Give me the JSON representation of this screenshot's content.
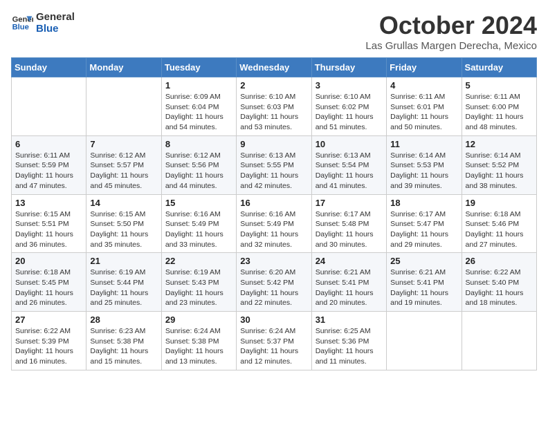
{
  "logo": {
    "line1": "General",
    "line2": "Blue"
  },
  "title": "October 2024",
  "location": "Las Grullas Margen Derecha, Mexico",
  "days_of_week": [
    "Sunday",
    "Monday",
    "Tuesday",
    "Wednesday",
    "Thursday",
    "Friday",
    "Saturday"
  ],
  "weeks": [
    [
      {
        "day": "",
        "info": ""
      },
      {
        "day": "",
        "info": ""
      },
      {
        "day": "1",
        "info": "Sunrise: 6:09 AM\nSunset: 6:04 PM\nDaylight: 11 hours and 54 minutes."
      },
      {
        "day": "2",
        "info": "Sunrise: 6:10 AM\nSunset: 6:03 PM\nDaylight: 11 hours and 53 minutes."
      },
      {
        "day": "3",
        "info": "Sunrise: 6:10 AM\nSunset: 6:02 PM\nDaylight: 11 hours and 51 minutes."
      },
      {
        "day": "4",
        "info": "Sunrise: 6:11 AM\nSunset: 6:01 PM\nDaylight: 11 hours and 50 minutes."
      },
      {
        "day": "5",
        "info": "Sunrise: 6:11 AM\nSunset: 6:00 PM\nDaylight: 11 hours and 48 minutes."
      }
    ],
    [
      {
        "day": "6",
        "info": "Sunrise: 6:11 AM\nSunset: 5:59 PM\nDaylight: 11 hours and 47 minutes."
      },
      {
        "day": "7",
        "info": "Sunrise: 6:12 AM\nSunset: 5:57 PM\nDaylight: 11 hours and 45 minutes."
      },
      {
        "day": "8",
        "info": "Sunrise: 6:12 AM\nSunset: 5:56 PM\nDaylight: 11 hours and 44 minutes."
      },
      {
        "day": "9",
        "info": "Sunrise: 6:13 AM\nSunset: 5:55 PM\nDaylight: 11 hours and 42 minutes."
      },
      {
        "day": "10",
        "info": "Sunrise: 6:13 AM\nSunset: 5:54 PM\nDaylight: 11 hours and 41 minutes."
      },
      {
        "day": "11",
        "info": "Sunrise: 6:14 AM\nSunset: 5:53 PM\nDaylight: 11 hours and 39 minutes."
      },
      {
        "day": "12",
        "info": "Sunrise: 6:14 AM\nSunset: 5:52 PM\nDaylight: 11 hours and 38 minutes."
      }
    ],
    [
      {
        "day": "13",
        "info": "Sunrise: 6:15 AM\nSunset: 5:51 PM\nDaylight: 11 hours and 36 minutes."
      },
      {
        "day": "14",
        "info": "Sunrise: 6:15 AM\nSunset: 5:50 PM\nDaylight: 11 hours and 35 minutes."
      },
      {
        "day": "15",
        "info": "Sunrise: 6:16 AM\nSunset: 5:49 PM\nDaylight: 11 hours and 33 minutes."
      },
      {
        "day": "16",
        "info": "Sunrise: 6:16 AM\nSunset: 5:49 PM\nDaylight: 11 hours and 32 minutes."
      },
      {
        "day": "17",
        "info": "Sunrise: 6:17 AM\nSunset: 5:48 PM\nDaylight: 11 hours and 30 minutes."
      },
      {
        "day": "18",
        "info": "Sunrise: 6:17 AM\nSunset: 5:47 PM\nDaylight: 11 hours and 29 minutes."
      },
      {
        "day": "19",
        "info": "Sunrise: 6:18 AM\nSunset: 5:46 PM\nDaylight: 11 hours and 27 minutes."
      }
    ],
    [
      {
        "day": "20",
        "info": "Sunrise: 6:18 AM\nSunset: 5:45 PM\nDaylight: 11 hours and 26 minutes."
      },
      {
        "day": "21",
        "info": "Sunrise: 6:19 AM\nSunset: 5:44 PM\nDaylight: 11 hours and 25 minutes."
      },
      {
        "day": "22",
        "info": "Sunrise: 6:19 AM\nSunset: 5:43 PM\nDaylight: 11 hours and 23 minutes."
      },
      {
        "day": "23",
        "info": "Sunrise: 6:20 AM\nSunset: 5:42 PM\nDaylight: 11 hours and 22 minutes."
      },
      {
        "day": "24",
        "info": "Sunrise: 6:21 AM\nSunset: 5:41 PM\nDaylight: 11 hours and 20 minutes."
      },
      {
        "day": "25",
        "info": "Sunrise: 6:21 AM\nSunset: 5:41 PM\nDaylight: 11 hours and 19 minutes."
      },
      {
        "day": "26",
        "info": "Sunrise: 6:22 AM\nSunset: 5:40 PM\nDaylight: 11 hours and 18 minutes."
      }
    ],
    [
      {
        "day": "27",
        "info": "Sunrise: 6:22 AM\nSunset: 5:39 PM\nDaylight: 11 hours and 16 minutes."
      },
      {
        "day": "28",
        "info": "Sunrise: 6:23 AM\nSunset: 5:38 PM\nDaylight: 11 hours and 15 minutes."
      },
      {
        "day": "29",
        "info": "Sunrise: 6:24 AM\nSunset: 5:38 PM\nDaylight: 11 hours and 13 minutes."
      },
      {
        "day": "30",
        "info": "Sunrise: 6:24 AM\nSunset: 5:37 PM\nDaylight: 11 hours and 12 minutes."
      },
      {
        "day": "31",
        "info": "Sunrise: 6:25 AM\nSunset: 5:36 PM\nDaylight: 11 hours and 11 minutes."
      },
      {
        "day": "",
        "info": ""
      },
      {
        "day": "",
        "info": ""
      }
    ]
  ]
}
